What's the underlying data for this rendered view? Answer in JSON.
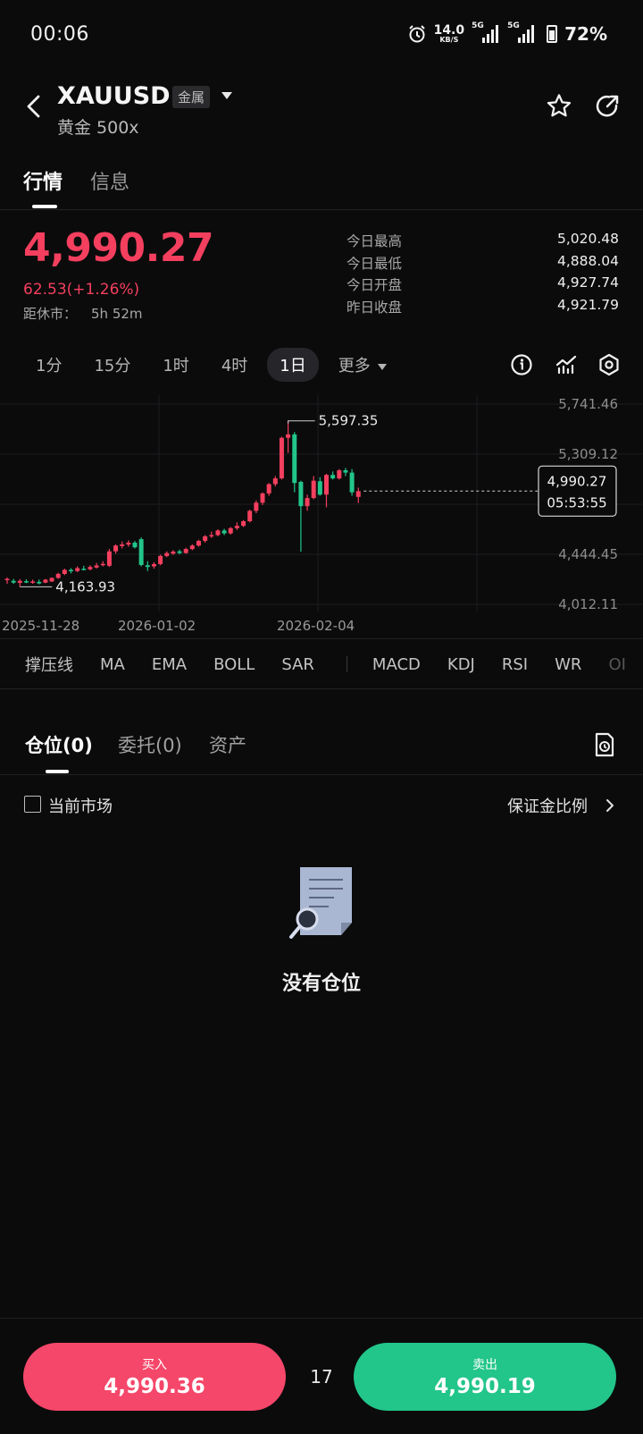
{
  "status_bar": {
    "time": "00:06",
    "speed_value": "14.0",
    "speed_unit": "KB/S",
    "net1": "5G",
    "net2": "5G",
    "battery": "72%"
  },
  "header": {
    "symbol": "XAUUSD",
    "category_tag": "金属",
    "subtitle": "黄金 500x"
  },
  "tabs": [
    {
      "label": "行情",
      "active": true
    },
    {
      "label": "信息",
      "active": false
    }
  ],
  "quote": {
    "price": "4,990.27",
    "change": "62.53(+1.26%)",
    "close_label": "距休市：",
    "close_time": "5h 52m",
    "stats": [
      {
        "k": "今日最高",
        "v": "5,020.48"
      },
      {
        "k": "今日最低",
        "v": "4,888.04"
      },
      {
        "k": "今日开盘",
        "v": "4,927.74"
      },
      {
        "k": "昨日收盘",
        "v": "4,921.79"
      }
    ]
  },
  "intervals": [
    {
      "label": "1分"
    },
    {
      "label": "15分"
    },
    {
      "label": "1时"
    },
    {
      "label": "4时"
    },
    {
      "label": "1日",
      "active": true
    },
    {
      "label": "更多"
    }
  ],
  "chart_data": {
    "type": "candlestick",
    "y_ticks": [
      "5,741.46",
      "5,309.12",
      "4,444.45",
      "4,012.11"
    ],
    "x_ticks": [
      "2025-11-28",
      "2026-01-02",
      "2026-02-04"
    ],
    "y_range": [
      4012.11,
      5741.46
    ],
    "annotation_high": "5,597.35",
    "annotation_low": "4,163.93",
    "current_price": "4,990.27",
    "countdown": "05:53:55",
    "colors": {
      "up": "#f43f5e",
      "down": "#22c58a"
    },
    "candles": [
      {
        "o": 4225,
        "h": 4245,
        "l": 4190,
        "c": 4232
      },
      {
        "o": 4215,
        "h": 4232,
        "l": 4190,
        "c": 4200
      },
      {
        "o": 4198,
        "h": 4230,
        "l": 4164,
        "c": 4215
      },
      {
        "o": 4212,
        "h": 4228,
        "l": 4195,
        "c": 4205
      },
      {
        "o": 4205,
        "h": 4225,
        "l": 4190,
        "c": 4210
      },
      {
        "o": 4206,
        "h": 4226,
        "l": 4185,
        "c": 4193
      },
      {
        "o": 4200,
        "h": 4232,
        "l": 4195,
        "c": 4225
      },
      {
        "o": 4210,
        "h": 4245,
        "l": 4205,
        "c": 4240
      },
      {
        "o": 4240,
        "h": 4285,
        "l": 4232,
        "c": 4275
      },
      {
        "o": 4275,
        "h": 4320,
        "l": 4265,
        "c": 4310
      },
      {
        "o": 4310,
        "h": 4325,
        "l": 4280,
        "c": 4300
      },
      {
        "o": 4300,
        "h": 4340,
        "l": 4290,
        "c": 4325
      },
      {
        "o": 4320,
        "h": 4345,
        "l": 4305,
        "c": 4312
      },
      {
        "o": 4315,
        "h": 4350,
        "l": 4305,
        "c": 4335
      },
      {
        "o": 4330,
        "h": 4370,
        "l": 4322,
        "c": 4348
      },
      {
        "o": 4350,
        "h": 4385,
        "l": 4340,
        "c": 4362
      },
      {
        "o": 4345,
        "h": 4490,
        "l": 4335,
        "c": 4470
      },
      {
        "o": 4470,
        "h": 4530,
        "l": 4450,
        "c": 4520
      },
      {
        "o": 4515,
        "h": 4555,
        "l": 4495,
        "c": 4530
      },
      {
        "o": 4528,
        "h": 4565,
        "l": 4510,
        "c": 4545
      },
      {
        "o": 4545,
        "h": 4560,
        "l": 4495,
        "c": 4505
      },
      {
        "o": 4575,
        "h": 4590,
        "l": 4340,
        "c": 4352
      },
      {
        "o": 4350,
        "h": 4385,
        "l": 4300,
        "c": 4335
      },
      {
        "o": 4340,
        "h": 4375,
        "l": 4320,
        "c": 4360
      },
      {
        "o": 4360,
        "h": 4440,
        "l": 4350,
        "c": 4430
      },
      {
        "o": 4430,
        "h": 4470,
        "l": 4420,
        "c": 4455
      },
      {
        "o": 4450,
        "h": 4480,
        "l": 4440,
        "c": 4468
      },
      {
        "o": 4470,
        "h": 4485,
        "l": 4445,
        "c": 4455
      },
      {
        "o": 4455,
        "h": 4500,
        "l": 4450,
        "c": 4490
      },
      {
        "o": 4490,
        "h": 4530,
        "l": 4480,
        "c": 4520
      },
      {
        "o": 4520,
        "h": 4570,
        "l": 4510,
        "c": 4560
      },
      {
        "o": 4560,
        "h": 4610,
        "l": 4545,
        "c": 4600
      },
      {
        "o": 4600,
        "h": 4640,
        "l": 4585,
        "c": 4610
      },
      {
        "o": 4610,
        "h": 4660,
        "l": 4600,
        "c": 4650
      },
      {
        "o": 4650,
        "h": 4665,
        "l": 4610,
        "c": 4625
      },
      {
        "o": 4625,
        "h": 4680,
        "l": 4615,
        "c": 4670
      },
      {
        "o": 4670,
        "h": 4720,
        "l": 4655,
        "c": 4690
      },
      {
        "o": 4690,
        "h": 4740,
        "l": 4680,
        "c": 4730
      },
      {
        "o": 4730,
        "h": 4830,
        "l": 4720,
        "c": 4820
      },
      {
        "o": 4820,
        "h": 4910,
        "l": 4800,
        "c": 4890
      },
      {
        "o": 4890,
        "h": 4980,
        "l": 4870,
        "c": 4970
      },
      {
        "o": 4970,
        "h": 5060,
        "l": 4950,
        "c": 5050
      },
      {
        "o": 5050,
        "h": 5120,
        "l": 5030,
        "c": 5100
      },
      {
        "o": 5100,
        "h": 5460,
        "l": 5090,
        "c": 5450
      },
      {
        "o": 5450,
        "h": 5597,
        "l": 5320,
        "c": 5480
      },
      {
        "o": 5480,
        "h": 5500,
        "l": 4980,
        "c": 5060
      },
      {
        "o": 5070,
        "h": 5080,
        "l": 4466,
        "c": 4860
      },
      {
        "o": 4860,
        "h": 4960,
        "l": 4820,
        "c": 4930
      },
      {
        "o": 4930,
        "h": 5120,
        "l": 4920,
        "c": 5080
      },
      {
        "o": 5075,
        "h": 5110,
        "l": 4950,
        "c": 4960
      },
      {
        "o": 4960,
        "h": 5140,
        "l": 4850,
        "c": 5130
      },
      {
        "o": 5130,
        "h": 5160,
        "l": 5090,
        "c": 5100
      },
      {
        "o": 5100,
        "h": 5180,
        "l": 5090,
        "c": 5170
      },
      {
        "o": 5170,
        "h": 5190,
        "l": 5120,
        "c": 5150
      },
      {
        "o": 5150,
        "h": 5180,
        "l": 4950,
        "c": 4980
      },
      {
        "o": 4940,
        "h": 5020,
        "l": 4888,
        "c": 4990
      }
    ]
  },
  "indicators": [
    "撑压线",
    "MA",
    "EMA",
    "BOLL",
    "SAR",
    "MACD",
    "KDJ",
    "RSI",
    "WR",
    "OI"
  ],
  "positions": {
    "tabs": [
      "仓位(0)",
      "委托(0)",
      "资产"
    ],
    "filter_label": "当前市场",
    "margin_link": "保证金比例",
    "empty_text": "没有仓位"
  },
  "trade": {
    "buy_label": "买入",
    "buy_price": "4,990.36",
    "spread": "17",
    "sell_label": "卖出",
    "sell_price": "4,990.19"
  }
}
